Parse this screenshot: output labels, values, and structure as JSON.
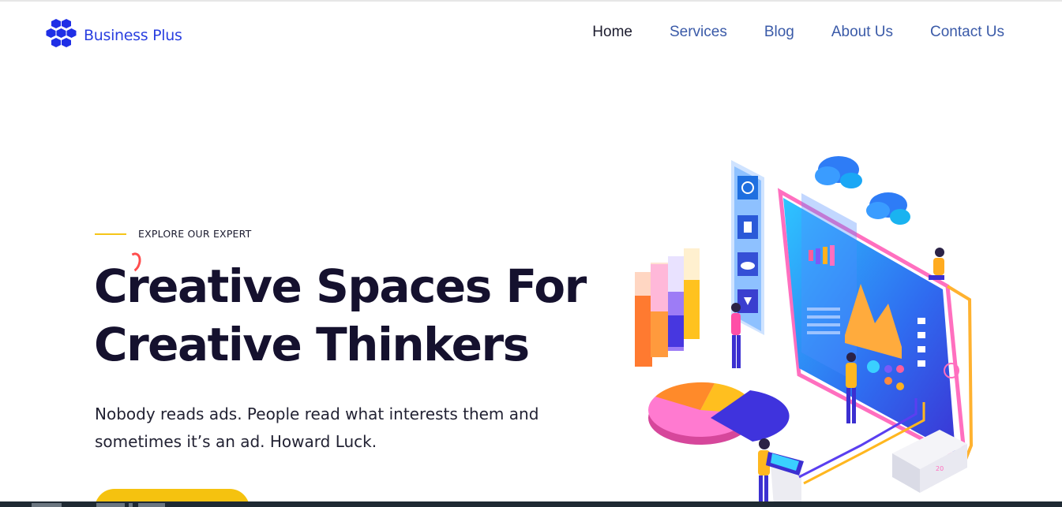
{
  "brand": {
    "name": "Business Plus",
    "logo_icon": "honeycomb-logo-icon",
    "color": "#2a3fe0"
  },
  "nav": {
    "items": [
      {
        "label": "Home",
        "active": true
      },
      {
        "label": "Services",
        "active": false
      },
      {
        "label": "Blog",
        "active": false
      },
      {
        "label": "About Us",
        "active": false
      },
      {
        "label": "Contact Us",
        "active": false
      }
    ]
  },
  "hero": {
    "eyebrow": "EXPLORE OUR EXPERT",
    "headline_line1": "Creative Spaces For",
    "headline_line2": "Creative Thinkers",
    "subtext_line1": "Nobody reads ads. People read what interests them and",
    "subtext_line2": "sometimes it’s an ad. Howard Luck.",
    "accent_color": "#f5c518",
    "headline_color": "#15112e"
  }
}
